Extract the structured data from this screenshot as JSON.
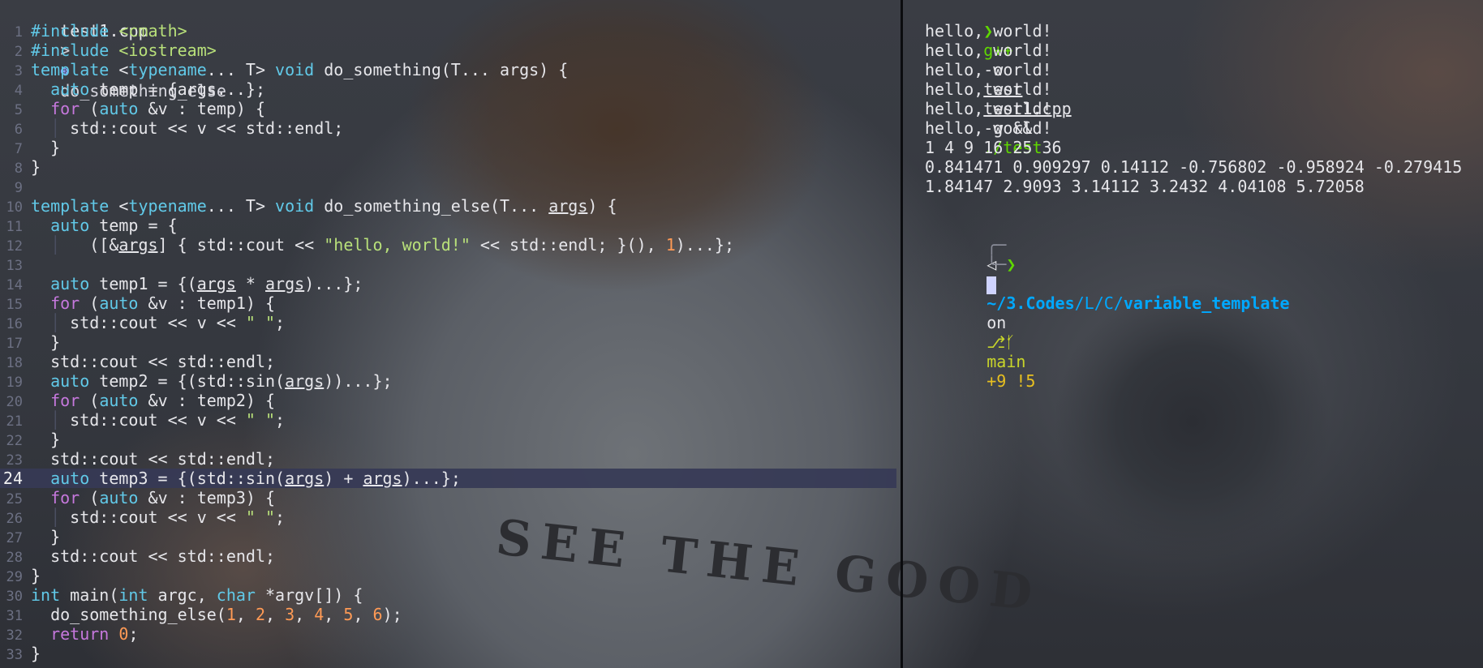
{
  "editor": {
    "breadcrumb": {
      "file": "test1.cpp",
      "separator": ">",
      "symbol_icon": "function-symbol-icon",
      "symbol": "do_something_else"
    },
    "current_line": 24,
    "lines": [
      {
        "n": "1",
        "tokens": [
          {
            "t": "#include ",
            "c": "pre"
          },
          {
            "t": "<cmath>",
            "c": "str"
          }
        ]
      },
      {
        "n": "2",
        "tokens": [
          {
            "t": "#include ",
            "c": "pre"
          },
          {
            "t": "<iostream>",
            "c": "str"
          }
        ]
      },
      {
        "n": "3",
        "tokens": [
          {
            "t": "template ",
            "c": "ty"
          },
          {
            "t": "<",
            "c": ""
          },
          {
            "t": "typename",
            "c": "ty"
          },
          {
            "t": "... T> ",
            "c": ""
          },
          {
            "t": "void",
            "c": "ty"
          },
          {
            "t": " do_something(T... args) {",
            "c": ""
          }
        ]
      },
      {
        "n": "4",
        "tokens": [
          {
            "t": "  ",
            "c": ""
          },
          {
            "t": "auto",
            "c": "ty"
          },
          {
            "t": " temp = {args...};",
            "c": ""
          }
        ]
      },
      {
        "n": "5",
        "tokens": [
          {
            "t": "  ",
            "c": ""
          },
          {
            "t": "for",
            "c": "kw"
          },
          {
            "t": " (",
            "c": ""
          },
          {
            "t": "auto",
            "c": "ty"
          },
          {
            "t": " &v : temp) {",
            "c": ""
          }
        ]
      },
      {
        "n": "6",
        "tokens": [
          {
            "t": "  │ ",
            "c": "guide"
          },
          {
            "t": "std::cout << v << std::endl;",
            "c": ""
          }
        ]
      },
      {
        "n": "7",
        "tokens": [
          {
            "t": "  }",
            "c": ""
          }
        ]
      },
      {
        "n": "8",
        "tokens": [
          {
            "t": "}",
            "c": ""
          }
        ]
      },
      {
        "n": "9",
        "tokens": []
      },
      {
        "n": "10",
        "tokens": [
          {
            "t": "template ",
            "c": "ty"
          },
          {
            "t": "<",
            "c": ""
          },
          {
            "t": "typename",
            "c": "ty"
          },
          {
            "t": "... T> ",
            "c": ""
          },
          {
            "t": "void",
            "c": "ty"
          },
          {
            "t": " do_something_else(T... ",
            "c": ""
          },
          {
            "t": "args",
            "c": "ul"
          },
          {
            "t": ") {",
            "c": ""
          }
        ]
      },
      {
        "n": "11",
        "tokens": [
          {
            "t": "  ",
            "c": ""
          },
          {
            "t": "auto",
            "c": "ty"
          },
          {
            "t": " temp = {",
            "c": ""
          }
        ]
      },
      {
        "n": "12",
        "tokens": [
          {
            "t": "  │   ",
            "c": "guide"
          },
          {
            "t": "([&",
            "c": ""
          },
          {
            "t": "args",
            "c": "ul"
          },
          {
            "t": "] { std::cout << ",
            "c": ""
          },
          {
            "t": "\"hello, world!\"",
            "c": "str"
          },
          {
            "t": " << std::endl; }(), ",
            "c": ""
          },
          {
            "t": "1",
            "c": "num"
          },
          {
            "t": ")...};",
            "c": ""
          }
        ]
      },
      {
        "n": "13",
        "tokens": []
      },
      {
        "n": "14",
        "tokens": [
          {
            "t": "  ",
            "c": ""
          },
          {
            "t": "auto",
            "c": "ty"
          },
          {
            "t": " temp1 = {(",
            "c": ""
          },
          {
            "t": "args",
            "c": "ul"
          },
          {
            "t": " * ",
            "c": ""
          },
          {
            "t": "args",
            "c": "ul"
          },
          {
            "t": ")...};",
            "c": ""
          }
        ]
      },
      {
        "n": "15",
        "tokens": [
          {
            "t": "  ",
            "c": ""
          },
          {
            "t": "for",
            "c": "kw"
          },
          {
            "t": " (",
            "c": ""
          },
          {
            "t": "auto",
            "c": "ty"
          },
          {
            "t": " &v : temp1) {",
            "c": ""
          }
        ]
      },
      {
        "n": "16",
        "tokens": [
          {
            "t": "  │ ",
            "c": "guide"
          },
          {
            "t": "std::cout << v << ",
            "c": ""
          },
          {
            "t": "\" \"",
            "c": "str"
          },
          {
            "t": ";",
            "c": ""
          }
        ]
      },
      {
        "n": "17",
        "tokens": [
          {
            "t": "  }",
            "c": ""
          }
        ]
      },
      {
        "n": "18",
        "tokens": [
          {
            "t": "  std::cout << std::endl;",
            "c": ""
          }
        ]
      },
      {
        "n": "19",
        "tokens": [
          {
            "t": "  ",
            "c": ""
          },
          {
            "t": "auto",
            "c": "ty"
          },
          {
            "t": " temp2 = {(std::sin(",
            "c": ""
          },
          {
            "t": "args",
            "c": "ul"
          },
          {
            "t": "))...};",
            "c": ""
          }
        ]
      },
      {
        "n": "20",
        "tokens": [
          {
            "t": "  ",
            "c": ""
          },
          {
            "t": "for",
            "c": "kw"
          },
          {
            "t": " (",
            "c": ""
          },
          {
            "t": "auto",
            "c": "ty"
          },
          {
            "t": " &v : temp2) {",
            "c": ""
          }
        ]
      },
      {
        "n": "21",
        "tokens": [
          {
            "t": "  │ ",
            "c": "guide"
          },
          {
            "t": "std::cout << v << ",
            "c": ""
          },
          {
            "t": "\" \"",
            "c": "str"
          },
          {
            "t": ";",
            "c": ""
          }
        ]
      },
      {
        "n": "22",
        "tokens": [
          {
            "t": "  }",
            "c": ""
          }
        ]
      },
      {
        "n": "23",
        "tokens": [
          {
            "t": "  std::cout << std::endl;",
            "c": ""
          }
        ]
      },
      {
        "n": "24",
        "tokens": [
          {
            "t": "  ",
            "c": ""
          },
          {
            "t": "auto",
            "c": "ty"
          },
          {
            "t": " temp3 = {(std::sin(",
            "c": ""
          },
          {
            "t": "args",
            "c": "ul"
          },
          {
            "t": ") + ",
            "c": ""
          },
          {
            "t": "args",
            "c": "ul"
          },
          {
            "t": ")...};",
            "c": ""
          }
        ]
      },
      {
        "n": "25",
        "tokens": [
          {
            "t": "  ",
            "c": ""
          },
          {
            "t": "for",
            "c": "kw"
          },
          {
            "t": " (",
            "c": ""
          },
          {
            "t": "auto",
            "c": "ty"
          },
          {
            "t": " &v : temp3) {",
            "c": ""
          }
        ]
      },
      {
        "n": "26",
        "tokens": [
          {
            "t": "  │ ",
            "c": "guide"
          },
          {
            "t": "std::cout << v << ",
            "c": ""
          },
          {
            "t": "\" \"",
            "c": "str"
          },
          {
            "t": ";",
            "c": ""
          }
        ]
      },
      {
        "n": "27",
        "tokens": [
          {
            "t": "  }",
            "c": ""
          }
        ]
      },
      {
        "n": "28",
        "tokens": [
          {
            "t": "  std::cout << std::endl;",
            "c": ""
          }
        ]
      },
      {
        "n": "29",
        "tokens": [
          {
            "t": "}",
            "c": ""
          }
        ]
      },
      {
        "n": "30",
        "tokens": [
          {
            "t": "int",
            "c": "ty"
          },
          {
            "t": " main(",
            "c": ""
          },
          {
            "t": "int",
            "c": "ty"
          },
          {
            "t": " argc, ",
            "c": ""
          },
          {
            "t": "char",
            "c": "ty"
          },
          {
            "t": " *argv[]) {",
            "c": ""
          }
        ]
      },
      {
        "n": "31",
        "tokens": [
          {
            "t": "  do_something_else(",
            "c": ""
          },
          {
            "t": "1",
            "c": "num"
          },
          {
            "t": ", ",
            "c": ""
          },
          {
            "t": "2",
            "c": "num"
          },
          {
            "t": ", ",
            "c": ""
          },
          {
            "t": "3",
            "c": "num"
          },
          {
            "t": ", ",
            "c": ""
          },
          {
            "t": "4",
            "c": "num"
          },
          {
            "t": ", ",
            "c": ""
          },
          {
            "t": "5",
            "c": "num"
          },
          {
            "t": ", ",
            "c": ""
          },
          {
            "t": "6",
            "c": "num"
          },
          {
            "t": ");",
            "c": ""
          }
        ]
      },
      {
        "n": "32",
        "tokens": [
          {
            "t": "  ",
            "c": ""
          },
          {
            "t": "return",
            "c": "kw"
          },
          {
            "t": " ",
            "c": ""
          },
          {
            "t": "0",
            "c": "num"
          },
          {
            "t": ";",
            "c": ""
          }
        ]
      },
      {
        "n": "33",
        "tokens": [
          {
            "t": "}",
            "c": ""
          }
        ]
      }
    ]
  },
  "terminal": {
    "command": {
      "prompt": "❯",
      "program": "g++",
      "flag_o": "-o",
      "out": "test",
      "source": "test1.cpp",
      "rest": "-g &&",
      "run": "./test"
    },
    "output": [
      "hello, world!",
      "hello, world!",
      "hello, world!",
      "hello, world!",
      "hello, world!",
      "hello, world!",
      "1 4 9 16 25 36",
      "0.841471 0.909297 0.14112 -0.756802 -0.958924 -0.279415",
      "1.84147 2.9093 3.14112 3.2432 4.04108 5.72058"
    ],
    "status_line": {
      "corner": "╭─",
      "os_icon": "◁",
      "folder_icon": "▸",
      "path_prefix": "~/",
      "path_bold1": "3.Codes",
      "path_mid": "/L/C/",
      "path_bold2": "variable_template",
      "on": "on",
      "git_icon": "⎇",
      "branch_icon": "ᚶ",
      "branch": "main",
      "status": "+9 !5"
    },
    "prompt_line": {
      "corner": "╰─",
      "prompt": "❯"
    }
  },
  "background": {
    "mug_text": "SEE THE GOOD"
  }
}
